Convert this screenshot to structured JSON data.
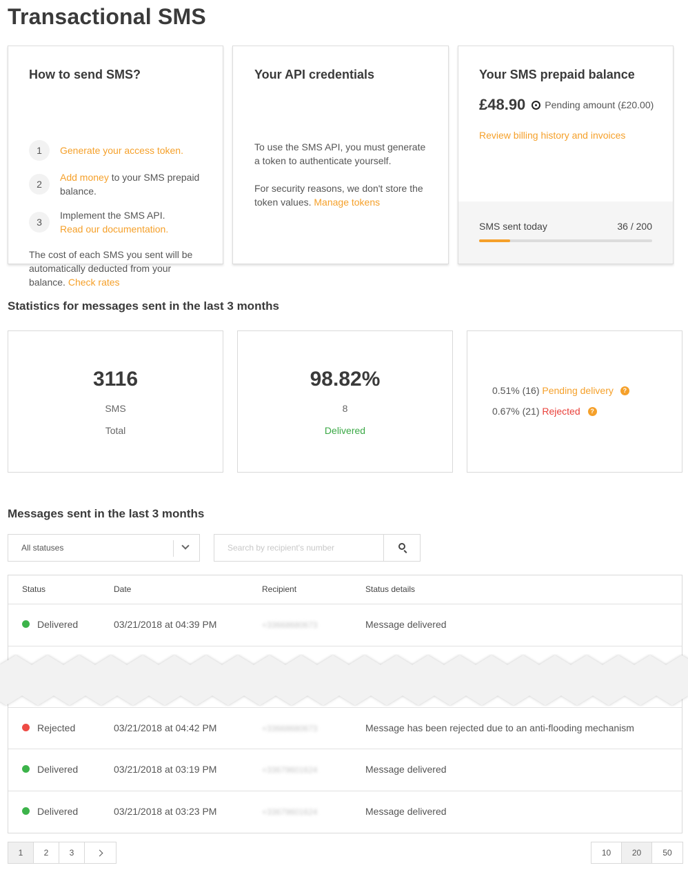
{
  "page_title": "Transactional SMS",
  "howto": {
    "title": "How to send SMS?",
    "steps": [
      {
        "num": "1",
        "link": "Generate your access token.",
        "text": ""
      },
      {
        "num": "2",
        "link": "Add money",
        "text": " to your SMS prepaid balance."
      },
      {
        "num": "3",
        "text": "Implement the SMS API.",
        "link": "Read our documentation."
      }
    ],
    "footer_text": "The cost of each SMS you sent will be automatically deducted from your balance. ",
    "footer_link": "Check rates"
  },
  "api": {
    "title": "Your API credentials",
    "p1": "To use the SMS API, you must generate a token to authenticate yourself.",
    "p2": "For security reasons, we don't store the token values. ",
    "p2_link": "Manage tokens"
  },
  "balance": {
    "title": "Your SMS prepaid balance",
    "amount": "£48.90",
    "pending": "Pending amount (£20.00)",
    "link": "Review billing history and invoices",
    "sent_label": "SMS sent today",
    "sent_count": "36 / 200",
    "sent_value": 36,
    "sent_max": 200
  },
  "stats": {
    "title": "Statistics for messages sent in the last 3 months",
    "total_value": "3116",
    "total_unit": "SMS",
    "total_label": "Total",
    "delivered_value": "98.82%",
    "delivered_count": "8",
    "delivered_label": "Delivered",
    "pending_prefix": "0.51% (16) ",
    "pending_label": "Pending delivery",
    "rejected_prefix": "0.67% (21) ",
    "rejected_label": "Rejected",
    "help_glyph": "?"
  },
  "messages": {
    "title": "Messages sent in the last 3 months",
    "filter_value": "All statuses",
    "search_placeholder": "Search by recipient's number",
    "headers": {
      "status": "Status",
      "date": "Date",
      "recipient": "Recipient",
      "details": "Status details"
    },
    "rows": [
      {
        "status": "Delivered",
        "status_color": "#3cb34a",
        "date": "03/21/2018 at 04:39 PM",
        "recipient": "+33668680673",
        "details": "Message delivered"
      },
      {
        "status": "Rejected",
        "status_color": "#ee4b45",
        "date": "03/21/2018 at 04:42 PM",
        "recipient": "+33668680673",
        "details": "Message has been rejected due to an anti-flooding mechanism"
      },
      {
        "status": "Delivered",
        "status_color": "#3cb34a",
        "date": "03/21/2018 at 03:19 PM",
        "recipient": "+33679601624",
        "details": "Message delivered"
      },
      {
        "status": "Delivered",
        "status_color": "#3cb34a",
        "date": "03/21/2018 at 03:23 PM",
        "recipient": "+33679601624",
        "details": "Message delivered"
      }
    ]
  },
  "pagination": {
    "pages": [
      "1",
      "2",
      "3"
    ],
    "active_page": "1",
    "page_sizes": [
      "10",
      "20",
      "50"
    ],
    "active_size": "20"
  },
  "colors": {
    "accent": "#f5a02a",
    "delivered": "#3cb34a",
    "rejected": "#ee4b45"
  }
}
